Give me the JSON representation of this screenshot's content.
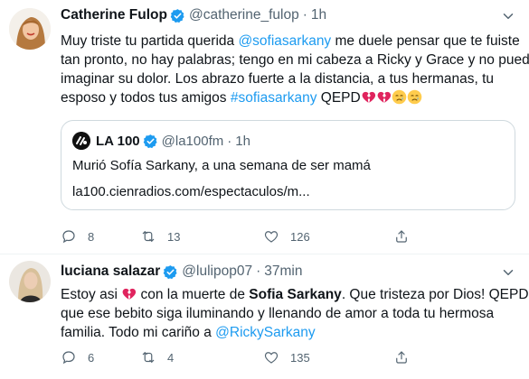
{
  "tweets": [
    {
      "author_name": "Catherine Fulop",
      "handle": "@catherine_fulop",
      "separator": "·",
      "time": "1h",
      "text_lines": [
        [
          {
            "t": "Muy triste tu partida querida ",
            "c": "n"
          },
          {
            "t": "@sofiasarkany",
            "c": "m"
          },
          {
            "t": " me duele pensar que te fuiste",
            "c": "n"
          }
        ],
        [
          {
            "t": "tan pronto, no hay palabras; tengo en mi cabeza a Ricky y Grace y no puedo",
            "c": "n"
          }
        ],
        [
          {
            "t": "imaginar su dolor. Los abrazo fuerte a la distancia, a tus hermanas, tu",
            "c": "n"
          }
        ],
        [
          {
            "t": "esposo y todos tus amigos ",
            "c": "n"
          },
          {
            "t": "#sofiasarkany",
            "c": "h"
          },
          {
            "t": " QEPD",
            "c": "n"
          }
        ]
      ],
      "emojis": [
        "broken-heart",
        "broken-heart",
        "crying-face",
        "crying-face"
      ],
      "quote": {
        "author_name": "LA 100",
        "handle": "@la100fm",
        "separator": "·",
        "time": "1h",
        "text": "Murió Sofía Sarkany, a una semana de ser mamá",
        "link": "la100.cienradios.com/espectaculos/m..."
      },
      "actions": {
        "replies": "8",
        "retweets": "13",
        "likes": "126"
      }
    },
    {
      "author_name": "luciana salazar",
      "handle": "@lulipop07",
      "separator": "·",
      "time": "37min",
      "text_lines": [
        [
          {
            "t": "Estoy asi ",
            "c": "n"
          },
          {
            "t": "EMOJI",
            "c": "e"
          },
          {
            "t": " con la muerte de ",
            "c": "n"
          },
          {
            "t": "Sofia Sarkany",
            "c": "b"
          },
          {
            "t": ". Que tristeza por Dios! QEPD y",
            "c": "n"
          }
        ],
        [
          {
            "t": "que ese bebito siga iluminando y llenando de amor a toda tu hermosa",
            "c": "n"
          }
        ],
        [
          {
            "t": "familia. Todo mi cariño a ",
            "c": "n"
          },
          {
            "t": "@RickySarkany",
            "c": "m"
          }
        ]
      ],
      "actions": {
        "replies": "6",
        "retweets": "4",
        "likes": "135"
      }
    }
  ],
  "colors": {
    "accent": "#1d9bf0",
    "muted": "#536471",
    "heart": "#e0245e"
  }
}
